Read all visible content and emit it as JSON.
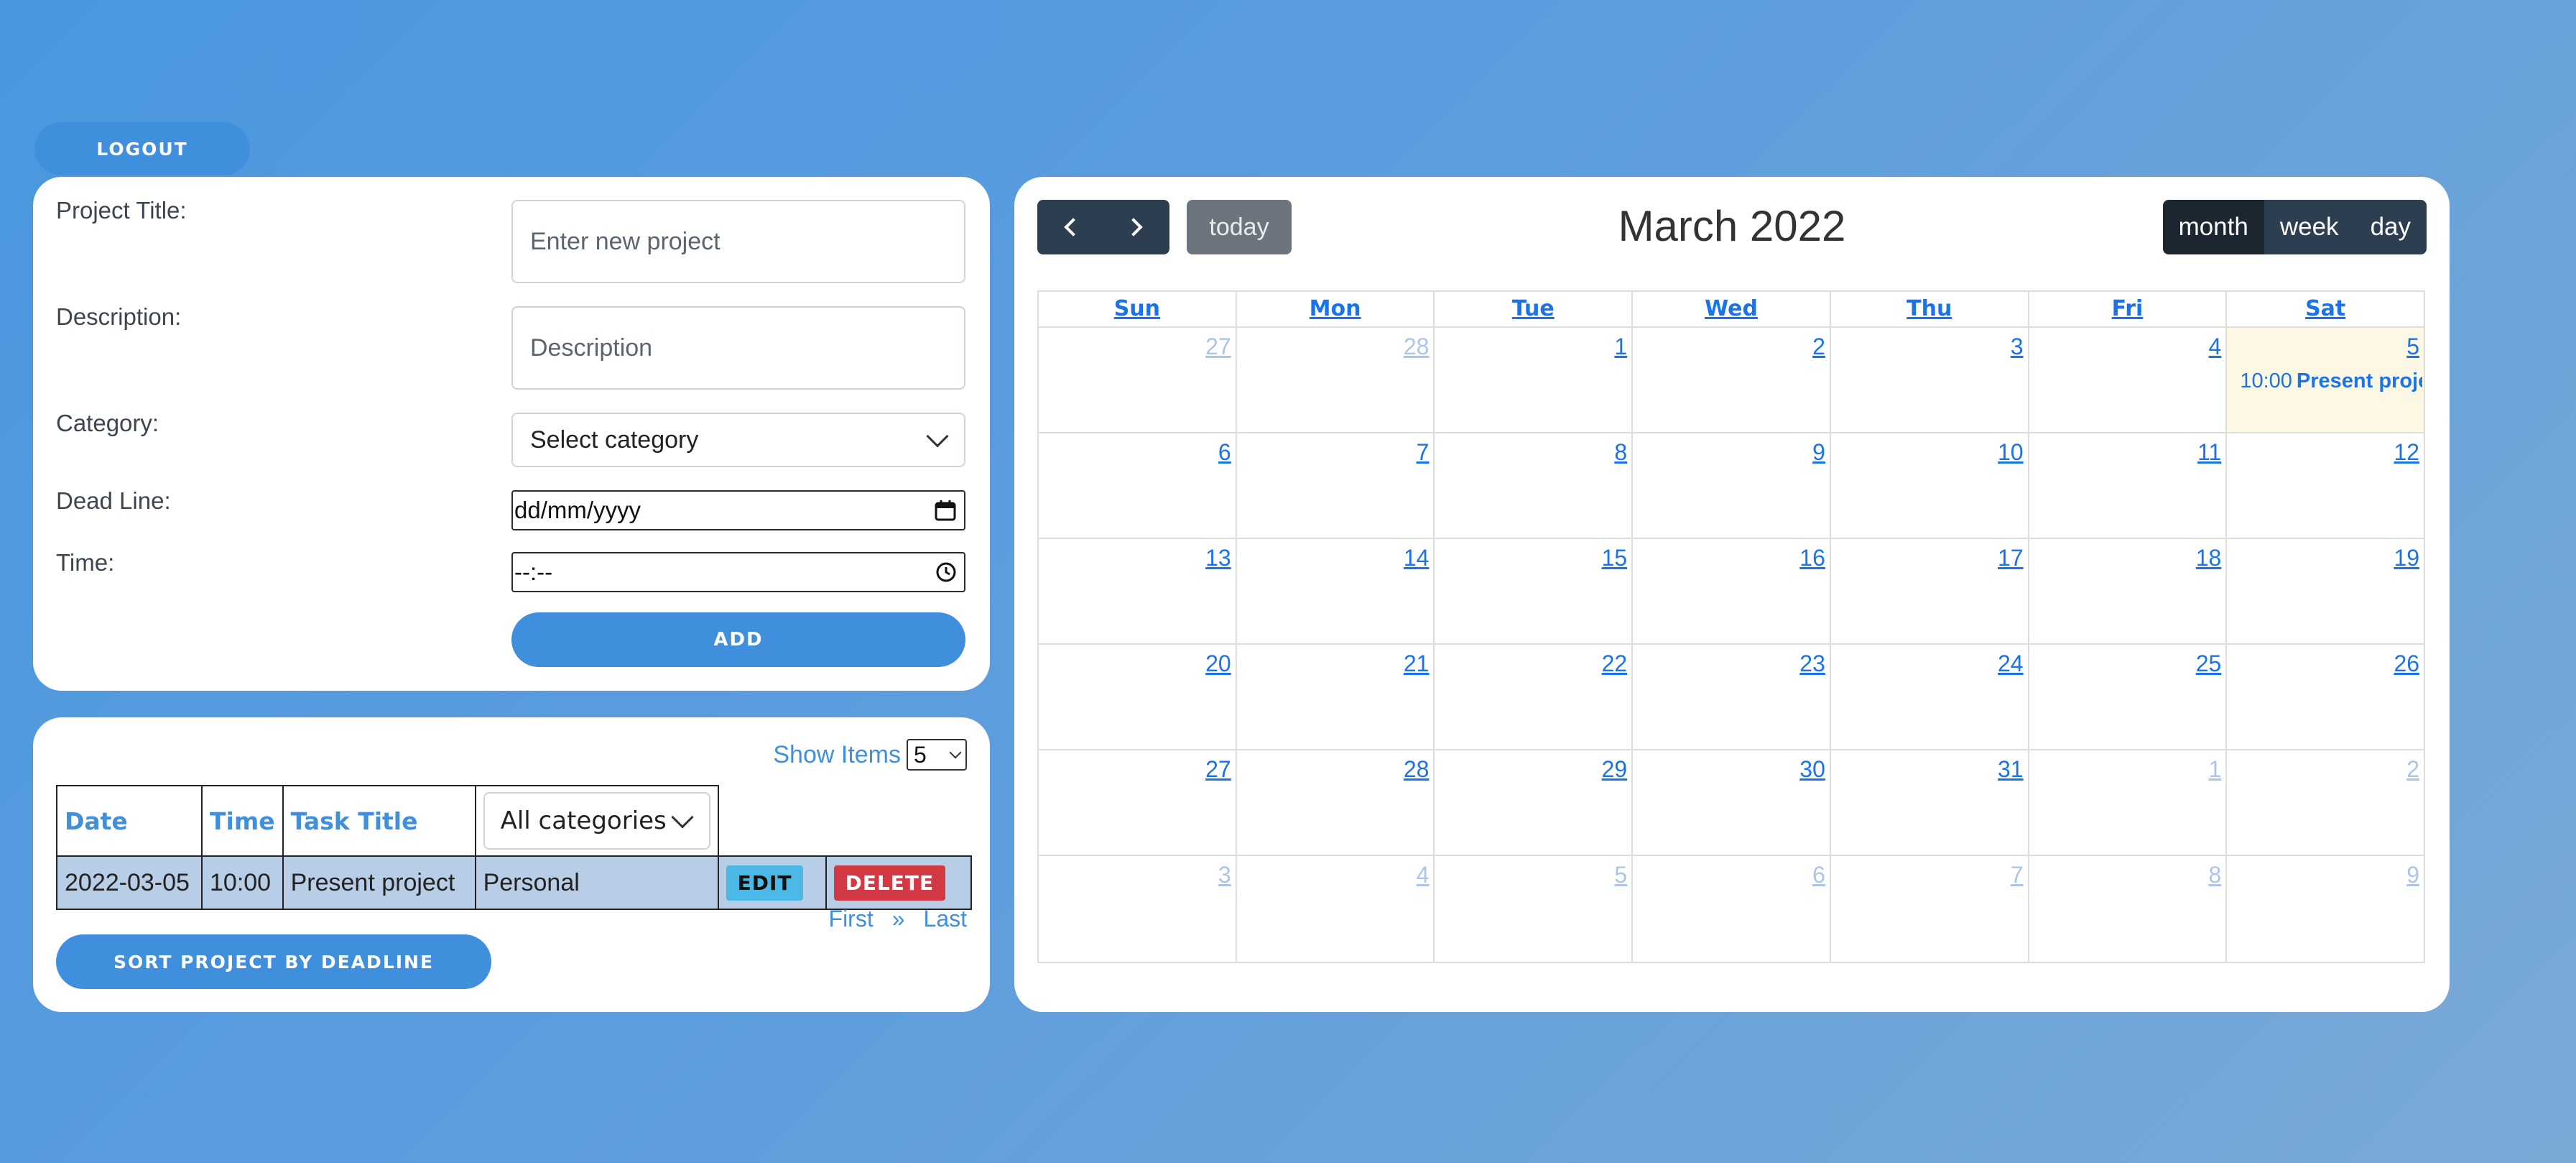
{
  "header": {
    "logout_label": "LOGOUT"
  },
  "form": {
    "project_title_label": "Project Title:",
    "project_title_placeholder": "Enter new project",
    "description_label": "Description:",
    "description_placeholder": "Description",
    "category_label": "Category:",
    "category_value": "Select category",
    "deadline_label": "Dead Line:",
    "deadline_value": "dd/mm/yyyy",
    "time_label": "Time:",
    "time_value": "--:--",
    "add_label": "ADD"
  },
  "list": {
    "show_items_label": "Show Items",
    "show_items_value": "5",
    "columns": {
      "date": "Date",
      "time": "Time",
      "title": "Task Title",
      "category_filter": "All categories"
    },
    "rows": [
      {
        "date": "2022-03-05",
        "time": "10:00",
        "title": "Present project",
        "category": "Personal",
        "edit": "EDIT",
        "delete": "DELETE"
      }
    ],
    "pager": {
      "first": "First",
      "next": "»",
      "last": "Last"
    },
    "sort_label": "SORT PROJECT BY DEADLINE"
  },
  "calendar": {
    "title": "March 2022",
    "today_label": "today",
    "views": [
      "month",
      "week",
      "day"
    ],
    "active_view": "month",
    "weekdays": [
      "Sun",
      "Mon",
      "Tue",
      "Wed",
      "Thu",
      "Fri",
      "Sat"
    ],
    "weeks": [
      [
        {
          "n": "27",
          "o": true
        },
        {
          "n": "28",
          "o": true
        },
        {
          "n": "1"
        },
        {
          "n": "2"
        },
        {
          "n": "3"
        },
        {
          "n": "4"
        },
        {
          "n": "5",
          "today": true
        }
      ],
      [
        {
          "n": "6"
        },
        {
          "n": "7"
        },
        {
          "n": "8"
        },
        {
          "n": "9"
        },
        {
          "n": "10"
        },
        {
          "n": "11"
        },
        {
          "n": "12"
        }
      ],
      [
        {
          "n": "13"
        },
        {
          "n": "14"
        },
        {
          "n": "15"
        },
        {
          "n": "16"
        },
        {
          "n": "17"
        },
        {
          "n": "18"
        },
        {
          "n": "19"
        }
      ],
      [
        {
          "n": "20"
        },
        {
          "n": "21"
        },
        {
          "n": "22"
        },
        {
          "n": "23"
        },
        {
          "n": "24"
        },
        {
          "n": "25"
        },
        {
          "n": "26"
        }
      ],
      [
        {
          "n": "27"
        },
        {
          "n": "28"
        },
        {
          "n": "29"
        },
        {
          "n": "30"
        },
        {
          "n": "31"
        },
        {
          "n": "1",
          "o": true
        },
        {
          "n": "2",
          "o": true
        }
      ],
      [
        {
          "n": "3",
          "o": true
        },
        {
          "n": "4",
          "o": true
        },
        {
          "n": "5",
          "o": true
        },
        {
          "n": "6",
          "o": true
        },
        {
          "n": "7",
          "o": true
        },
        {
          "n": "8",
          "o": true
        },
        {
          "n": "9",
          "o": true
        }
      ]
    ],
    "event": {
      "time": "10:00",
      "title": "Present project"
    }
  }
}
